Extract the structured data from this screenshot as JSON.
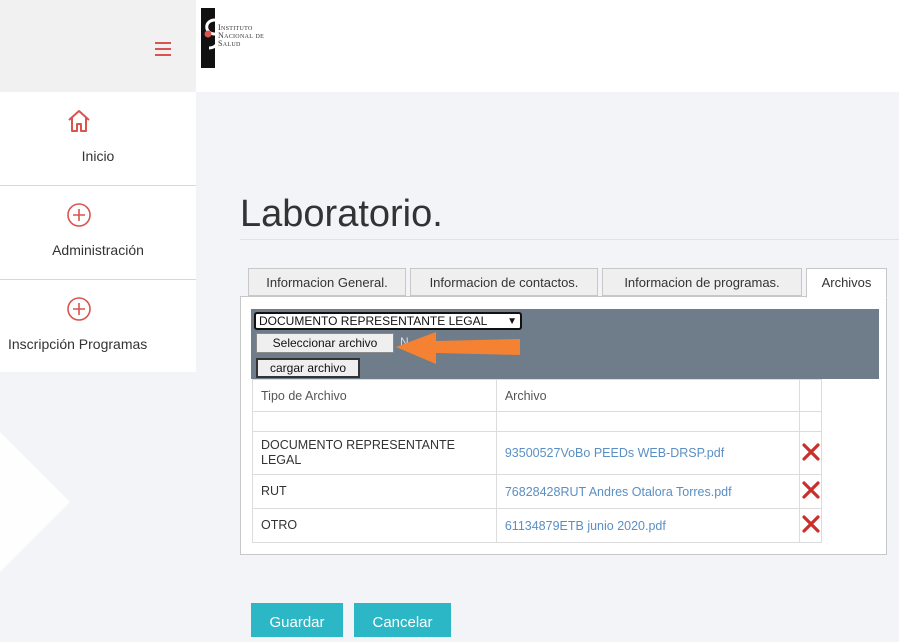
{
  "header": {
    "logo_lines": [
      "Instituto",
      "Nacional de",
      "Salud"
    ]
  },
  "sidebar": {
    "items": [
      {
        "label": "Inicio",
        "icon": "home-icon"
      },
      {
        "label": "Administración",
        "icon": "plus-circle-icon"
      },
      {
        "label": "Inscripción Programas",
        "icon": "plus-circle-icon"
      }
    ]
  },
  "main": {
    "title": "Laboratorio.",
    "tabs": [
      {
        "label": "Informacion General."
      },
      {
        "label": "Informacion de contactos."
      },
      {
        "label": "Informacion de programas."
      },
      {
        "label": "Archivos",
        "active": true
      }
    ],
    "upload": {
      "select_value": "DOCUMENTO REPRESENTANTE LEGAL",
      "file_button": "Seleccionar archivo",
      "file_status": "N...ec.",
      "upload_button": "cargar archivo"
    },
    "table": {
      "columns": [
        "Tipo de Archivo",
        "Archivo",
        ""
      ],
      "rows": [
        {
          "tipo": "DOCUMENTO REPRESENTANTE LEGAL",
          "archivo": "93500527VoBo PEEDs WEB-DRSP.pdf"
        },
        {
          "tipo": "RUT",
          "archivo": "76828428RUT Andres Otalora Torres.pdf"
        },
        {
          "tipo": "OTRO",
          "archivo": "61134879ETB junio 2020.pdf"
        }
      ]
    },
    "buttons": {
      "save": "Guardar",
      "cancel": "Cancelar"
    }
  },
  "colors": {
    "accent": "#2bb7c6",
    "danger": "#d9534f",
    "link": "#5a8fc4",
    "upload_bar": "#6f7c8a",
    "arrow": "#f58232"
  }
}
